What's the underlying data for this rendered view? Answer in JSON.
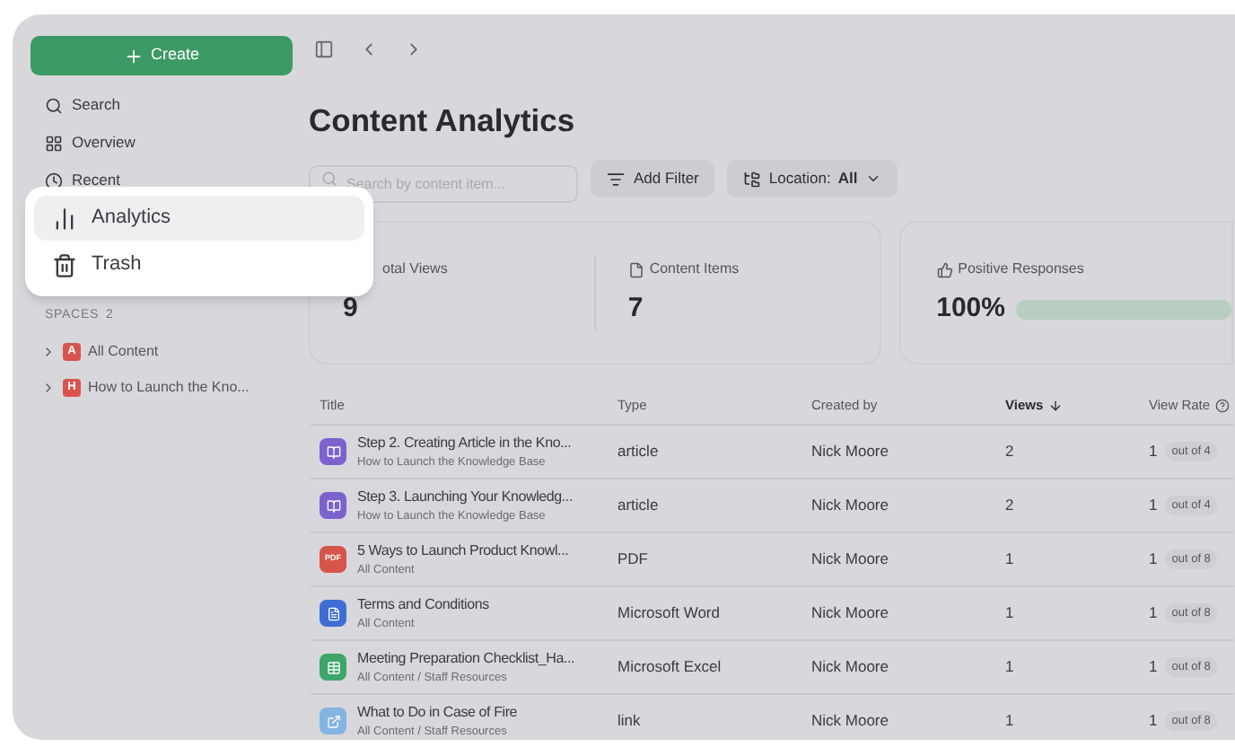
{
  "sidebar": {
    "create_button": "Create",
    "nav": [
      {
        "label": "Search",
        "kind": "search"
      },
      {
        "label": "Overview",
        "kind": "overview"
      },
      {
        "label": "Recent",
        "kind": "recent"
      }
    ],
    "spaces": {
      "label": "SPACES",
      "count": "2",
      "items": [
        {
          "letter": "A",
          "label": "All Content",
          "color": "#d9534f"
        },
        {
          "letter": "H",
          "label": "How to Launch the Kno...",
          "color": "#d9534f"
        }
      ]
    }
  },
  "popup": {
    "items": [
      {
        "label": "Analytics",
        "kind": "analytics",
        "selected": true
      },
      {
        "label": "Trash",
        "kind": "trash",
        "selected": false
      }
    ]
  },
  "page": {
    "title": "Content Analytics",
    "search": {
      "placeholder": "Search by content item..."
    },
    "filter_button": "Add Filter",
    "location": {
      "label": "Location:",
      "value": "All"
    }
  },
  "stats": [
    {
      "label": "otal Views",
      "value": "9",
      "kind": "views"
    },
    {
      "label": "Content Items",
      "value": "7",
      "kind": "items"
    },
    {
      "label": "Positive Responses",
      "value": "100%",
      "kind": "responses",
      "level": 1
    }
  ],
  "table": {
    "columns": [
      {
        "label": "Title",
        "sorted": false
      },
      {
        "label": "Type",
        "sorted": false
      },
      {
        "label": "Created by",
        "sorted": false
      },
      {
        "label": "Views",
        "sorted": true
      },
      {
        "label": "View Rate",
        "sorted": false
      }
    ],
    "rows": [
      {
        "kind": "article",
        "title": "Step 2. Creating Article in the Kno...",
        "location": "How to Launch the Knowledge Base",
        "type": "article",
        "created_by": "Nick Moore",
        "views": "2",
        "rate": "1",
        "out_of": "out of 4"
      },
      {
        "kind": "article",
        "title": "Step 3. Launching Your Knowledg...",
        "location": "How to Launch the Knowledge Base",
        "type": "article",
        "created_by": "Nick Moore",
        "views": "2",
        "rate": "1",
        "out_of": "out of 4"
      },
      {
        "kind": "pdf",
        "icon_text": "PDF",
        "title": "5 Ways to Launch Product Knowl...",
        "location": "All Content",
        "type": "PDF",
        "created_by": "Nick Moore",
        "views": "1",
        "rate": "1",
        "out_of": "out of 8"
      },
      {
        "kind": "word",
        "title": "Terms and Conditions",
        "location": "All Content",
        "type": "Microsoft Word",
        "created_by": "Nick Moore",
        "views": "1",
        "rate": "1",
        "out_of": "out of 8"
      },
      {
        "kind": "excel",
        "title": "Meeting Preparation Checklist_Ha...",
        "location": "All Content / Staff Resources",
        "type": "Microsoft Excel",
        "created_by": "Nick Moore",
        "views": "1",
        "rate": "1",
        "out_of": "out of 8"
      },
      {
        "kind": "link",
        "title": "What to Do in Case of Fire",
        "location": "All Content / Staff Resources",
        "type": "link",
        "created_by": "Nick Moore",
        "views": "1",
        "rate": "1",
        "out_of": "out of 8"
      }
    ]
  }
}
